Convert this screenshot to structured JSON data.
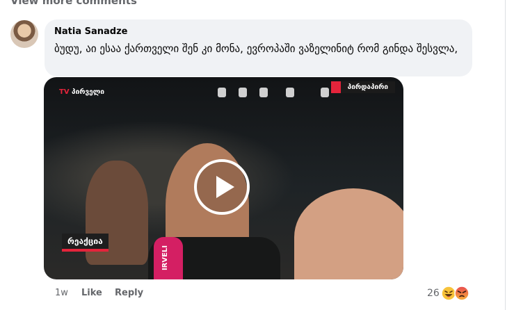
{
  "thread": {
    "view_more_label": "View more comments"
  },
  "comment": {
    "author": "Natia Sanadze",
    "text": "ბუდუ, აი ესაა ქართველი შენ კი მონა, ევროპაში ვაზელინიტ რომ გინდა შესვლა,",
    "time": "1w",
    "like_label": "Like",
    "reply_label": "Reply",
    "reaction_count": "26",
    "reaction_icons": [
      "laughing-emoji-icon",
      "angry-emoji-icon"
    ]
  },
  "video": {
    "channel_label": "პირველი",
    "tv_mark": "TV",
    "live_badge": "პირდაპირი",
    "overlay_badge": "რეაქცია",
    "mic_label": "IRVELI"
  },
  "colors": {
    "bubble_bg": "#f0f2f5",
    "meta_text": "#65676b",
    "brand_red": "#e4243b",
    "mic_pink": "#d41f63"
  }
}
